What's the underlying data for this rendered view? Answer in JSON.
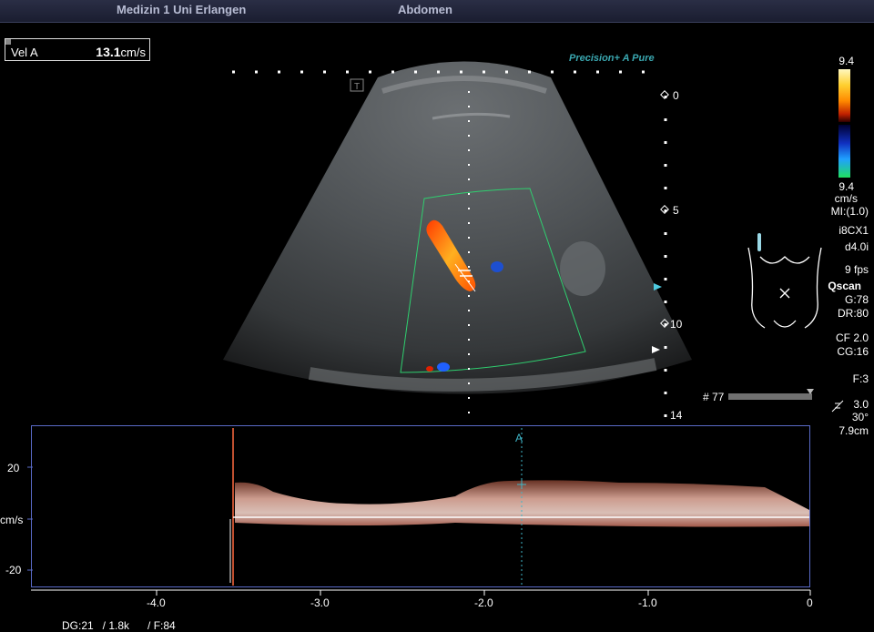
{
  "header": {
    "institution": "Medizin 1 Uni Erlangen",
    "preset": "Abdomen"
  },
  "velocity_box": {
    "label": "Vel A",
    "value": "13.1",
    "unit": "cm/s"
  },
  "mode_label": "Precision+ A Pure",
  "color_scale": {
    "max": "9.4",
    "min": "9.4",
    "unit": "cm/s"
  },
  "params": {
    "mi": "MI:(1.0)",
    "probe": "i8CX1",
    "depth": "d4.0i",
    "fps": "9 fps",
    "qscan": "Qscan",
    "gain": "G:78",
    "dr": "DR:80",
    "cf": "CF 2.0",
    "cg": "CG:16",
    "focus": "F:3",
    "sv": "3.0",
    "angle": "30°",
    "depth_cm": "7.9cm"
  },
  "depth_marks": [
    "0",
    "5",
    "10",
    "14"
  ],
  "frame_counter": "# 77",
  "cursor_label": "A",
  "doppler": {
    "y_ticks": [
      "20",
      "cm/s",
      "-20"
    ],
    "x_ticks": [
      "-4.0",
      "-3.0",
      "-2.0",
      "-1.0",
      "0"
    ]
  },
  "footer": "DG:21   / 1.8k      / F:84"
}
